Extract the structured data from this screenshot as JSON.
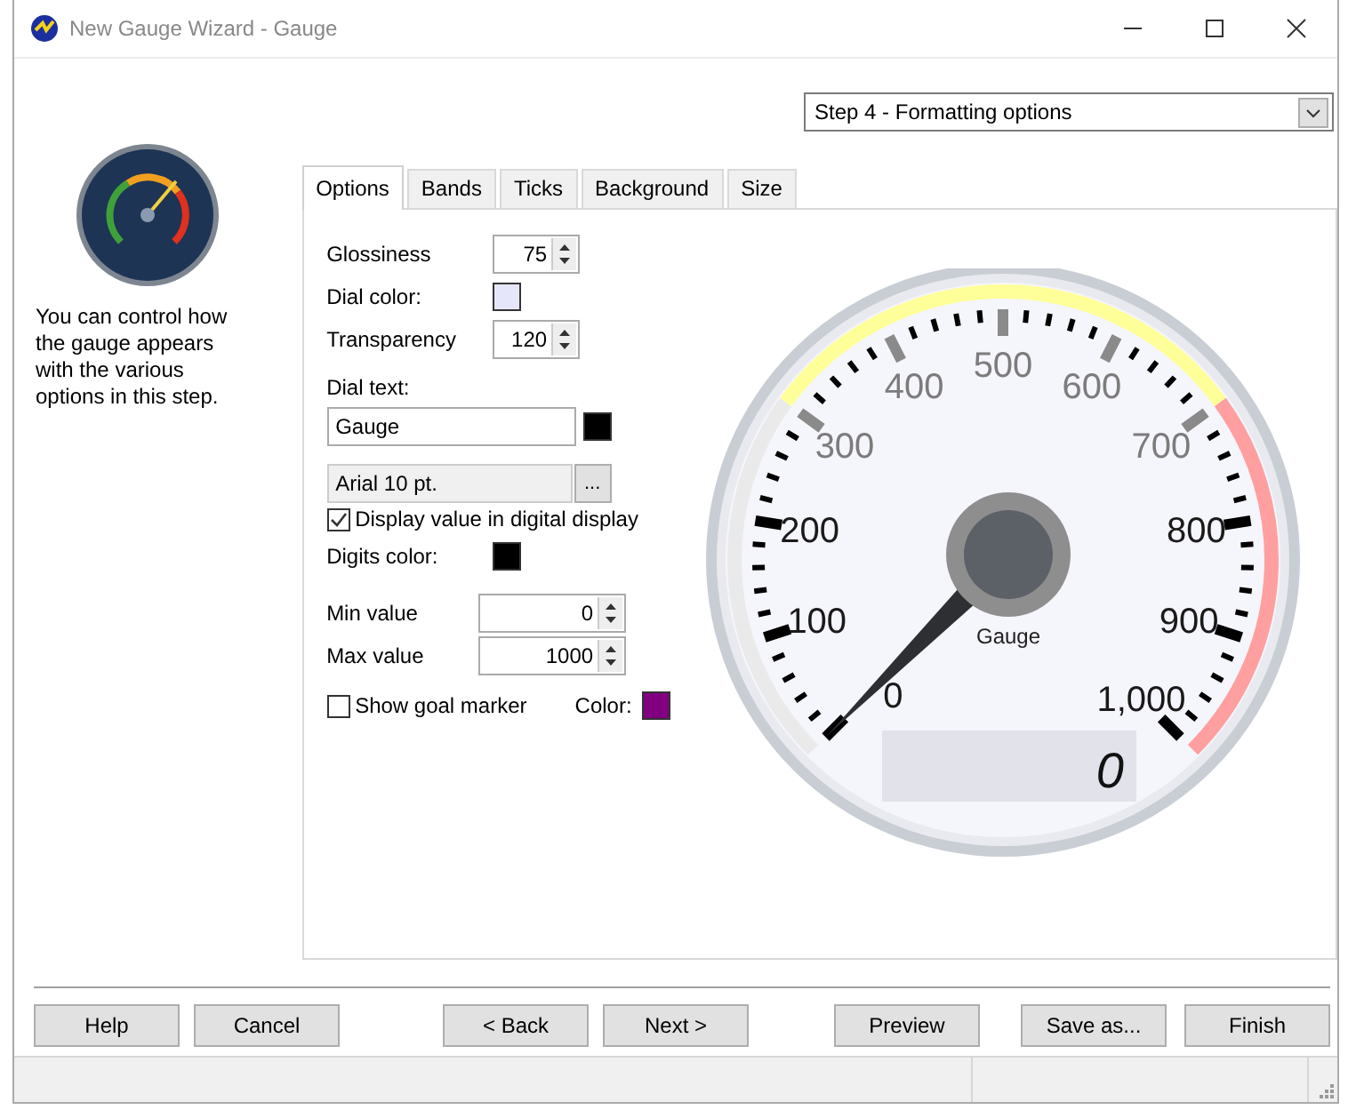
{
  "window": {
    "title": "New Gauge Wizard - Gauge"
  },
  "step_dropdown": {
    "value": "Step 4 - Formatting options"
  },
  "sidebar": {
    "description": "You can control how the gauge appears with the various options in this step."
  },
  "tabs": [
    {
      "label": "Options",
      "selected": true
    },
    {
      "label": "Bands",
      "selected": false
    },
    {
      "label": "Ticks",
      "selected": false
    },
    {
      "label": "Background",
      "selected": false
    },
    {
      "label": "Size",
      "selected": false
    }
  ],
  "options": {
    "glossiness": {
      "label": "Glossiness",
      "value": "75"
    },
    "dial_color": {
      "label": "Dial color:",
      "color": "#e6e6fa"
    },
    "transparency": {
      "label": "Transparency",
      "value": "120"
    },
    "dial_text": {
      "label": "Dial text:",
      "value": "Gauge",
      "color": "#000000"
    },
    "font": {
      "value": "Arial 10 pt.",
      "button": "..."
    },
    "digital_display": {
      "label": "Display value in digital display",
      "checked": true
    },
    "digits_color": {
      "label": "Digits color:",
      "color": "#000000"
    },
    "min_value": {
      "label": "Min value",
      "value": "0"
    },
    "max_value": {
      "label": "Max value",
      "value": "1000"
    },
    "goal_marker": {
      "label": "Show goal marker",
      "checked": false
    },
    "goal_color": {
      "label": "Color:",
      "color": "#800080"
    }
  },
  "gauge": {
    "labels": [
      "0",
      "100",
      "200",
      "300",
      "400",
      "500",
      "600",
      "700",
      "800",
      "900",
      "1,000"
    ],
    "dial_text": "Gauge",
    "digital_value": "0"
  },
  "button_groups": [
    [
      "Help",
      "Cancel"
    ],
    [
      "< Back",
      "Next >"
    ],
    [
      "Preview"
    ],
    [
      "Save as...",
      "Finish"
    ]
  ]
}
